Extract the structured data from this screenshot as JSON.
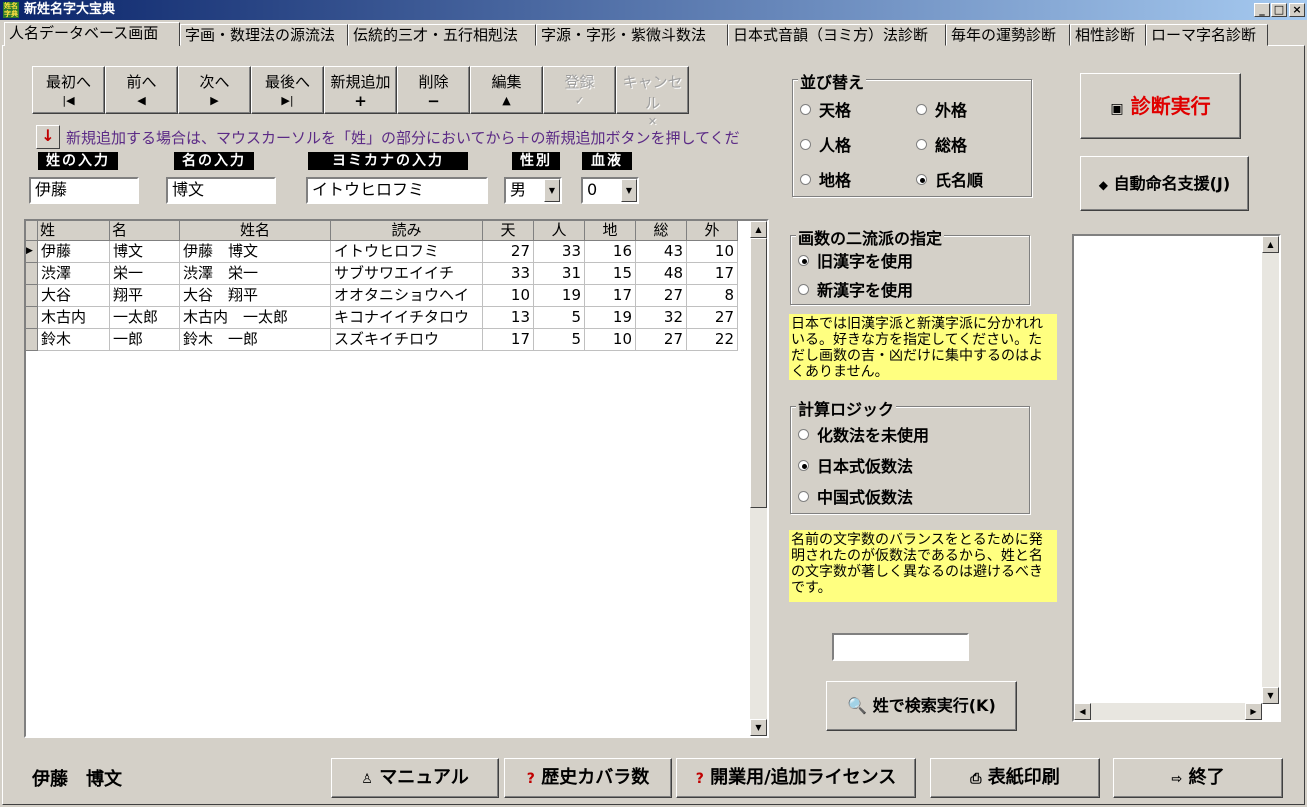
{
  "window": {
    "title": "新姓名字大宝典",
    "icon_text": "姓名字典",
    "minimize": "_",
    "maximize": "□",
    "close": "×"
  },
  "tabs": [
    "人名データベース画面",
    "字画・数理法の源流法",
    "伝統的三才・五行相剋法",
    "字源・字形・紫微斗数法",
    "日本式音韻（ヨミ方）法診断",
    "毎年の運勢診断",
    "相性診断",
    "ローマ字名診断"
  ],
  "nav": {
    "first": "最初へ",
    "prev": "前へ",
    "next": "次へ",
    "last": "最後へ",
    "add": "新規追加",
    "delete": "削除",
    "edit": "編集",
    "register": "登録",
    "cancel": "キャンセル"
  },
  "hint": "新規追加する場合は、マウスカーソルを「姓」の部分においてから＋の新規追加ボタンを押してくだ",
  "inputs": {
    "surname_label": "姓の入力",
    "surname_value": "伊藤",
    "given_label": "名の入力",
    "given_value": "博文",
    "kana_label": "ヨミカナの入力",
    "kana_value": "イトウヒロフミ",
    "gender_label": "性別",
    "gender_value": "男",
    "blood_label": "血液",
    "blood_value": "0"
  },
  "grid": {
    "headers": [
      "姓",
      "名",
      "姓名",
      "読み",
      "天",
      "人",
      "地",
      "総",
      "外"
    ],
    "rows": [
      [
        "伊藤",
        "博文",
        "伊藤　博文",
        "イトウヒロフミ",
        "27",
        "33",
        "16",
        "43",
        "10"
      ],
      [
        "渋澤",
        "栄一",
        "渋澤　栄一",
        "サブサワエイイチ",
        "33",
        "31",
        "15",
        "48",
        "17"
      ],
      [
        "大谷",
        "翔平",
        "大谷　翔平",
        "オオタニショウヘイ",
        "10",
        "19",
        "17",
        "27",
        "8"
      ],
      [
        "木古内",
        "一太郎",
        "木古内　一太郎",
        "キコナイイチタロウ",
        "13",
        "5",
        "19",
        "32",
        "27"
      ],
      [
        "鈴木",
        "一郎",
        "鈴木　一郎",
        "スズキイチロウ",
        "17",
        "5",
        "10",
        "27",
        "22"
      ]
    ]
  },
  "sort": {
    "title": "並び替え",
    "options": [
      "天格",
      "外格",
      "人格",
      "総格",
      "地格",
      "氏名順"
    ],
    "selected": "氏名順"
  },
  "stroke": {
    "title": "画数の二流派の指定",
    "options": [
      "旧漢字を使用",
      "新漢字を使用"
    ],
    "selected": "旧漢字を使用",
    "note": "日本では旧漢字派と新漢字派に分かれれいる。好きな方を指定してください。ただし画数の吉・凶だけに集中するのはよくありません。"
  },
  "logic": {
    "title": "計算ロジック",
    "options": [
      "化数法を未使用",
      "日本式仮数法",
      "中国式仮数法"
    ],
    "selected": "日本式仮数法",
    "note": "名前の文字数のバランスをとるために発明されたのが仮数法であるから、姓と名の文字数が著しく異なるのは避けるべきです。"
  },
  "buttons": {
    "diagnose": "診断実行",
    "auto_naming": "自動命名支援(J)",
    "search_surname": "姓で検索実行(K)",
    "manual": "マニュアル",
    "history": "歴史カバラ数",
    "license": "開業用/追加ライセンス",
    "print_cover": "表紙印刷",
    "exit": "終了"
  },
  "footer": {
    "current_name": "伊藤　博文"
  },
  "colors": {
    "diagnose_text": "#e00000",
    "hint_text": "#5b2a86",
    "note_bg": "#ffff80"
  }
}
